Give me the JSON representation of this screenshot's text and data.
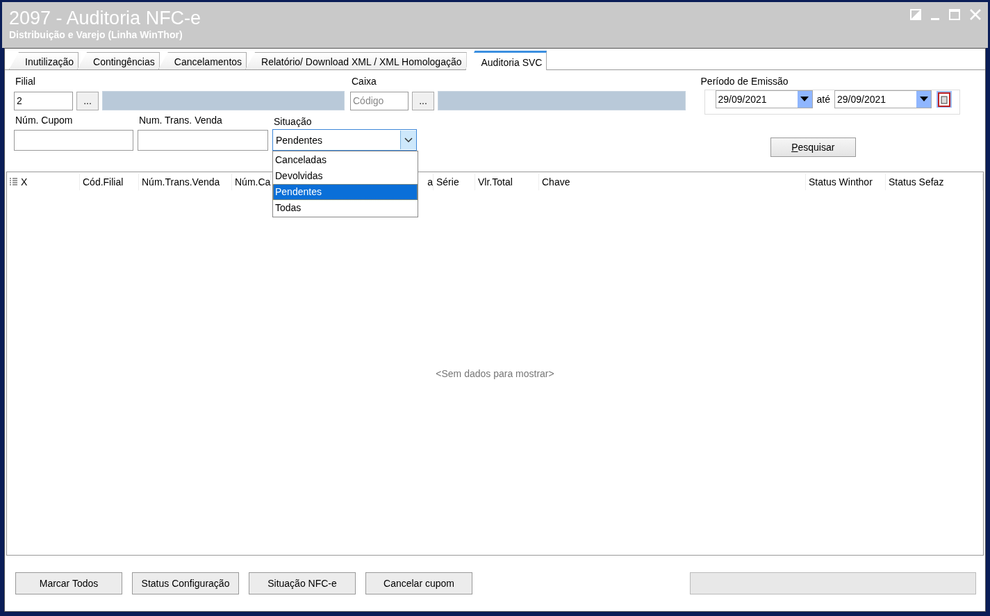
{
  "window": {
    "title": "2097 - Auditoria NFC-e",
    "subtitle": "Distribuição e Varejo (Linha WinThor)"
  },
  "tabs": [
    {
      "label": "Inutilização",
      "selected": false
    },
    {
      "label": "Contingências",
      "selected": false
    },
    {
      "label": "Cancelamentos",
      "selected": false
    },
    {
      "label": "Relatório/ Download XML / XML Homologação",
      "selected": false
    },
    {
      "label": "Auditoria SVC",
      "selected": true
    }
  ],
  "filial": {
    "label": "Filial",
    "value": "2",
    "browse_button": "..."
  },
  "caixa": {
    "label": "Caixa",
    "placeholder": "Código",
    "browse_button": "..."
  },
  "periodo": {
    "label": "Período de Emissão",
    "from": "29/09/2021",
    "separator": "até",
    "to": "29/09/2021"
  },
  "num_cupom": {
    "label": "Núm. Cupom"
  },
  "num_trans_venda": {
    "label": "Num. Trans. Venda"
  },
  "situacao": {
    "label": "Situação",
    "value": "Pendentes",
    "expanded": true,
    "options": [
      {
        "label": "Canceladas",
        "selected": false
      },
      {
        "label": "Devolvidas",
        "selected": false
      },
      {
        "label": "Pendentes",
        "selected": true
      },
      {
        "label": "Todas",
        "selected": false
      }
    ]
  },
  "search_button": "Pesquisar",
  "grid": {
    "columns": [
      "X",
      "Cód.Filial",
      "Núm.Trans.Venda",
      "Núm.Ca",
      "a",
      "Série",
      "Vlr.Total",
      "Chave",
      "Status Winthor",
      "Status Sefaz"
    ],
    "empty_text": "<Sem dados para mostrar>"
  },
  "buttons": [
    "Marcar Todos",
    "Status Configuração",
    "Situação NFC-e",
    "Cancelar cupom"
  ]
}
